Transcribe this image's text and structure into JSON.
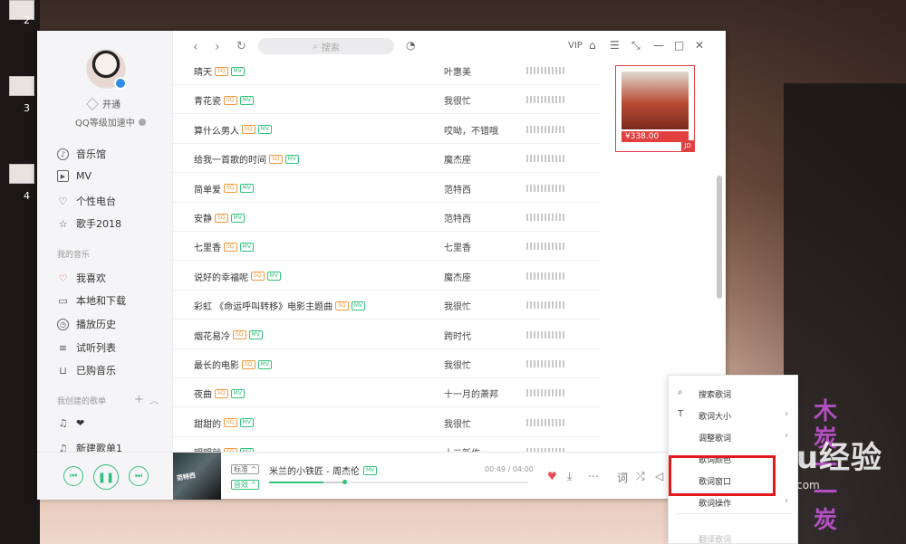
{
  "desktop": {
    "icon_labels": [
      "2",
      "3",
      "4"
    ],
    "watermark_main": "Baidu经验",
    "watermark_sub": "jingyan.baidu.com",
    "calligraphy": "木炭一一炭"
  },
  "sidebar": {
    "vip_label": "开通",
    "level_label": "QQ等级加速中",
    "nav_items": [
      {
        "label": "音乐馆",
        "icon": "music-hall-icon"
      },
      {
        "label": "MV",
        "icon": "mv-icon"
      },
      {
        "label": "个性电台",
        "icon": "radio-icon"
      },
      {
        "label": "歌手2018",
        "icon": "star-icon"
      }
    ],
    "my_music_title": "我的音乐",
    "my_music_items": [
      {
        "label": "我喜欢",
        "icon": "heart-icon"
      },
      {
        "label": "本地和下载",
        "icon": "monitor-icon"
      },
      {
        "label": "播放历史",
        "icon": "clock-icon"
      },
      {
        "label": "试听列表",
        "icon": "list-icon"
      },
      {
        "label": "已购音乐",
        "icon": "cart-icon"
      }
    ],
    "created_title": "我创建的歌单",
    "playlists": [
      {
        "label": "❤",
        "icon": "note-icon"
      },
      {
        "label": "新建歌单1",
        "icon": "note-icon"
      }
    ]
  },
  "topbar": {
    "search_placeholder": "搜索",
    "vip": "VIP"
  },
  "songs": [
    {
      "title": "晴天",
      "sq": "SQ",
      "mv": "MV",
      "artist": "叶惠美"
    },
    {
      "title": "青花瓷",
      "sq": "SQ",
      "mv": "MV",
      "artist": "我很忙"
    },
    {
      "title": "算什么男人",
      "sq": "SQ",
      "mv": "MV",
      "artist": "哎呦，不错哦"
    },
    {
      "title": "给我一首歌的时间",
      "sq": "SQ",
      "mv": "MV",
      "artist": "魔杰座"
    },
    {
      "title": "简单爱",
      "sq": "SQ",
      "mv": "MV",
      "artist": "范特西"
    },
    {
      "title": "安静",
      "sq": "SQ",
      "mv": "MV",
      "artist": "范特西"
    },
    {
      "title": "七里香",
      "sq": "SQ",
      "mv": "MV",
      "artist": "七里香"
    },
    {
      "title": "说好的幸福呢",
      "sq": "SQ",
      "mv": "MV",
      "artist": "魔杰座"
    },
    {
      "title": "彩虹 《命运呼叫转移》电影主题曲",
      "sq": "SQ",
      "mv": "MV",
      "artist": "我很忙"
    },
    {
      "title": "烟花易冷",
      "sq": "SQ",
      "mv": "MV",
      "artist": "跨时代"
    },
    {
      "title": "最长的电影",
      "sq": "SQ",
      "mv": "MV",
      "artist": "我很忙"
    },
    {
      "title": "夜曲",
      "sq": "SQ",
      "mv": "MV",
      "artist": "十一月的萧邦"
    },
    {
      "title": "甜甜的",
      "sq": "SQ",
      "mv": "MV",
      "artist": "我很忙"
    },
    {
      "title": "明明就",
      "sq": "SQ",
      "mv": "MV",
      "artist": "十二新作"
    }
  ],
  "ad": {
    "price": "¥338.00",
    "badge": "JD"
  },
  "player": {
    "quality": "标准",
    "effect": "音效",
    "song": "米兰的小铁匠 - 周杰伦",
    "mv": "MV",
    "time": "00:49 / 04:00",
    "progress": 0.21,
    "buffered": 0.29,
    "cover_text": "范特西",
    "colors": {
      "accent": "#31c27c",
      "heart": "#e74c5a"
    }
  },
  "menu": {
    "items": [
      {
        "label": "搜索歌词",
        "icon": "search-icon",
        "arrow": ""
      },
      {
        "label": "歌词大小",
        "icon": "text-size-icon",
        "arrow": "›"
      },
      {
        "label": "调整歌词",
        "icon": "",
        "arrow": "›"
      },
      {
        "label": "歌词颜色",
        "icon": "",
        "arrow": ""
      },
      {
        "label": "歌词窗口",
        "icon": "",
        "arrow": ""
      },
      {
        "label": "歌词操作",
        "icon": "",
        "arrow": "›"
      },
      {
        "label": "翻译歌词",
        "icon": "",
        "arrow": ""
      }
    ]
  }
}
